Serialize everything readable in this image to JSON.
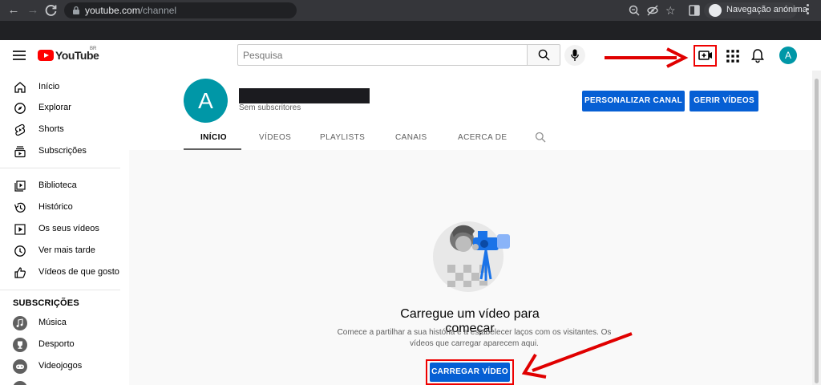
{
  "browser": {
    "url_host": "youtube.com",
    "url_path": "/channel",
    "incognito_label": "Navegação anónima"
  },
  "header": {
    "logo_text": "YouTube",
    "region_code": "BR",
    "search_placeholder": "Pesquisa"
  },
  "sidebar": {
    "main_items": [
      {
        "label": "Início",
        "icon": "home-icon"
      },
      {
        "label": "Explorar",
        "icon": "compass-icon"
      },
      {
        "label": "Shorts",
        "icon": "shorts-icon"
      },
      {
        "label": "Subscrições",
        "icon": "subscriptions-icon"
      }
    ],
    "library_items": [
      {
        "label": "Biblioteca",
        "icon": "library-icon"
      },
      {
        "label": "Histórico",
        "icon": "history-icon"
      },
      {
        "label": "Os seus vídeos",
        "icon": "your-videos-icon"
      },
      {
        "label": "Ver mais tarde",
        "icon": "clock-icon"
      },
      {
        "label": "Vídeos de que gosto",
        "icon": "thumbs-up-icon"
      }
    ],
    "subscriptions_heading": "SUBSCRIÇÕES",
    "subscriptions": [
      {
        "label": "Música",
        "icon": "music-icon"
      },
      {
        "label": "Desporto",
        "icon": "trophy-icon"
      },
      {
        "label": "Videojogos",
        "icon": "gamepad-icon"
      }
    ]
  },
  "channel": {
    "avatar_letter": "A",
    "subscribers": "Sem subscritores",
    "customize_button": "PERSONALIZAR CANAL",
    "manage_button": "GERIR VÍDEOS",
    "tabs": [
      "INÍCIO",
      "VÍDEOS",
      "PLAYLISTS",
      "CANAIS",
      "ACERCA DE"
    ],
    "active_tab": "INÍCIO"
  },
  "empty_state": {
    "title": "Carregue um vídeo para começar",
    "description": "Comece a partilhar a sua história e a estabelecer laços com os visitantes. Os vídeos que carregar aparecem aqui.",
    "upload_button": "CARREGAR VÍDEO"
  },
  "colors": {
    "brand_red": "#ff0000",
    "accent_blue": "#065fd4",
    "avatar_teal": "#0097a7",
    "annotation_red": "#e00000"
  }
}
